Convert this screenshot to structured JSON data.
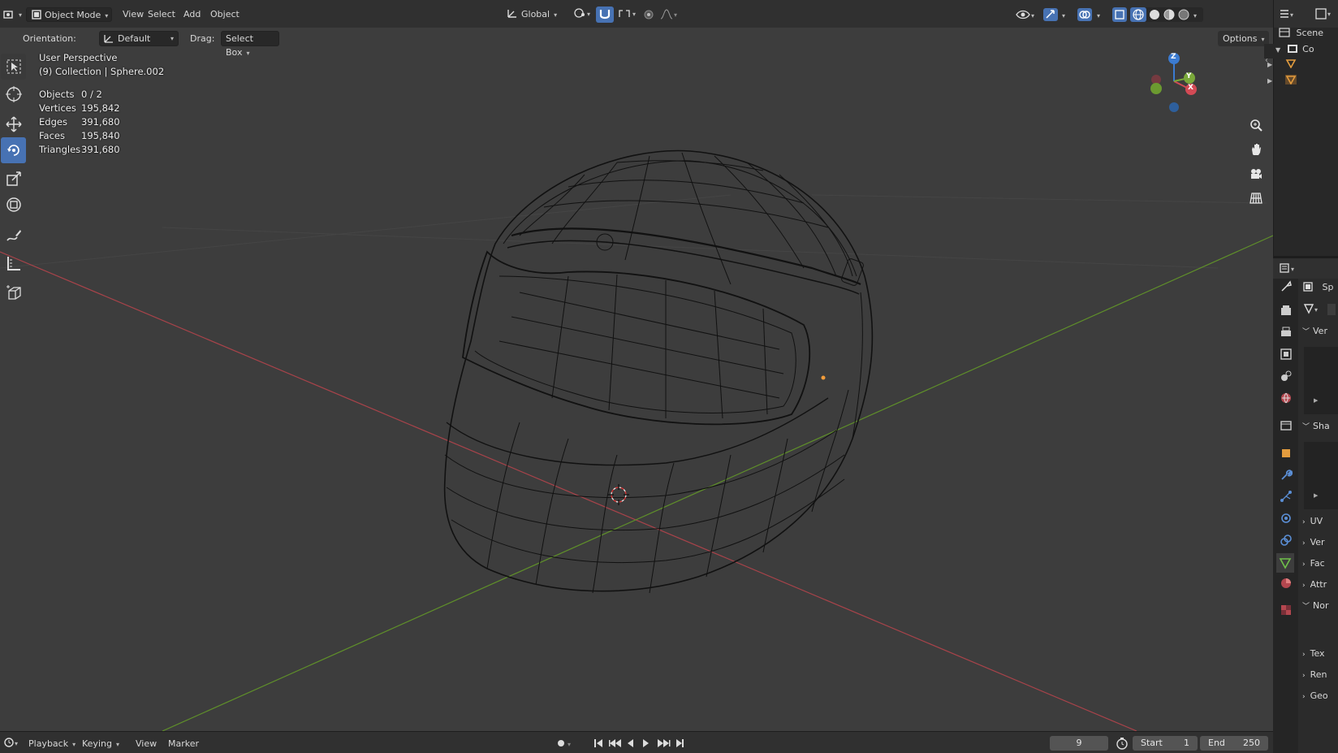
{
  "header": {
    "mode": "Object Mode",
    "menu": [
      "View",
      "Select",
      "Add",
      "Object"
    ],
    "transform_orientation": "Global"
  },
  "tool_settings": {
    "orientation_label": "Orientation:",
    "orientation_value": "Default",
    "drag_label": "Drag:",
    "drag_value": "Select Box",
    "options": "Options"
  },
  "viewport": {
    "view_name": "User Perspective",
    "collection": "(9) Collection | Sphere.002",
    "stats": [
      {
        "label": "Objects",
        "value": "0 / 2"
      },
      {
        "label": "Vertices",
        "value": "195,842"
      },
      {
        "label": "Edges",
        "value": "391,680"
      },
      {
        "label": "Faces",
        "value": "195,840"
      },
      {
        "label": "Triangles",
        "value": "391,680"
      }
    ],
    "gizmo": {
      "x": "X",
      "y": "Y",
      "z": "Z"
    }
  },
  "outliner": {
    "scene": "Scene",
    "collection": "Co"
  },
  "properties": {
    "object_name": "Sp",
    "sections": [
      "Ver",
      "Sha",
      "UV",
      "Ver",
      "Fac",
      "Attr",
      "Nor",
      "Tex",
      "Ren",
      "Geo"
    ]
  },
  "timeline": {
    "menu": [
      "Playback",
      "Keying",
      "View",
      "Marker"
    ],
    "current_frame": "9",
    "start_label": "Start",
    "start_value": "1",
    "end_label": "End",
    "end_value": "250"
  },
  "colors": {
    "accent": "#4772b3",
    "x_axis": "#b5434e",
    "y_axis": "#6a9a2c",
    "z_axis": "#3b7bd1"
  }
}
